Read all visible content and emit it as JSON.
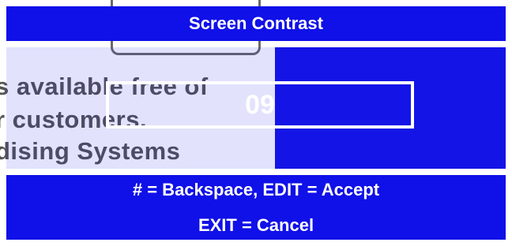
{
  "title": "Screen Contrast",
  "contrast_value": "09",
  "hints": {
    "line1": "# = Backspace, EDIT = Accept",
    "line2": "EXIT = Cancel"
  },
  "background_text": {
    "line1": "s available free of",
    "line2": "r customers.",
    "line3": "dising Systems"
  },
  "colors": {
    "panel_blue": "#1010e8",
    "text": "#ffffff"
  }
}
